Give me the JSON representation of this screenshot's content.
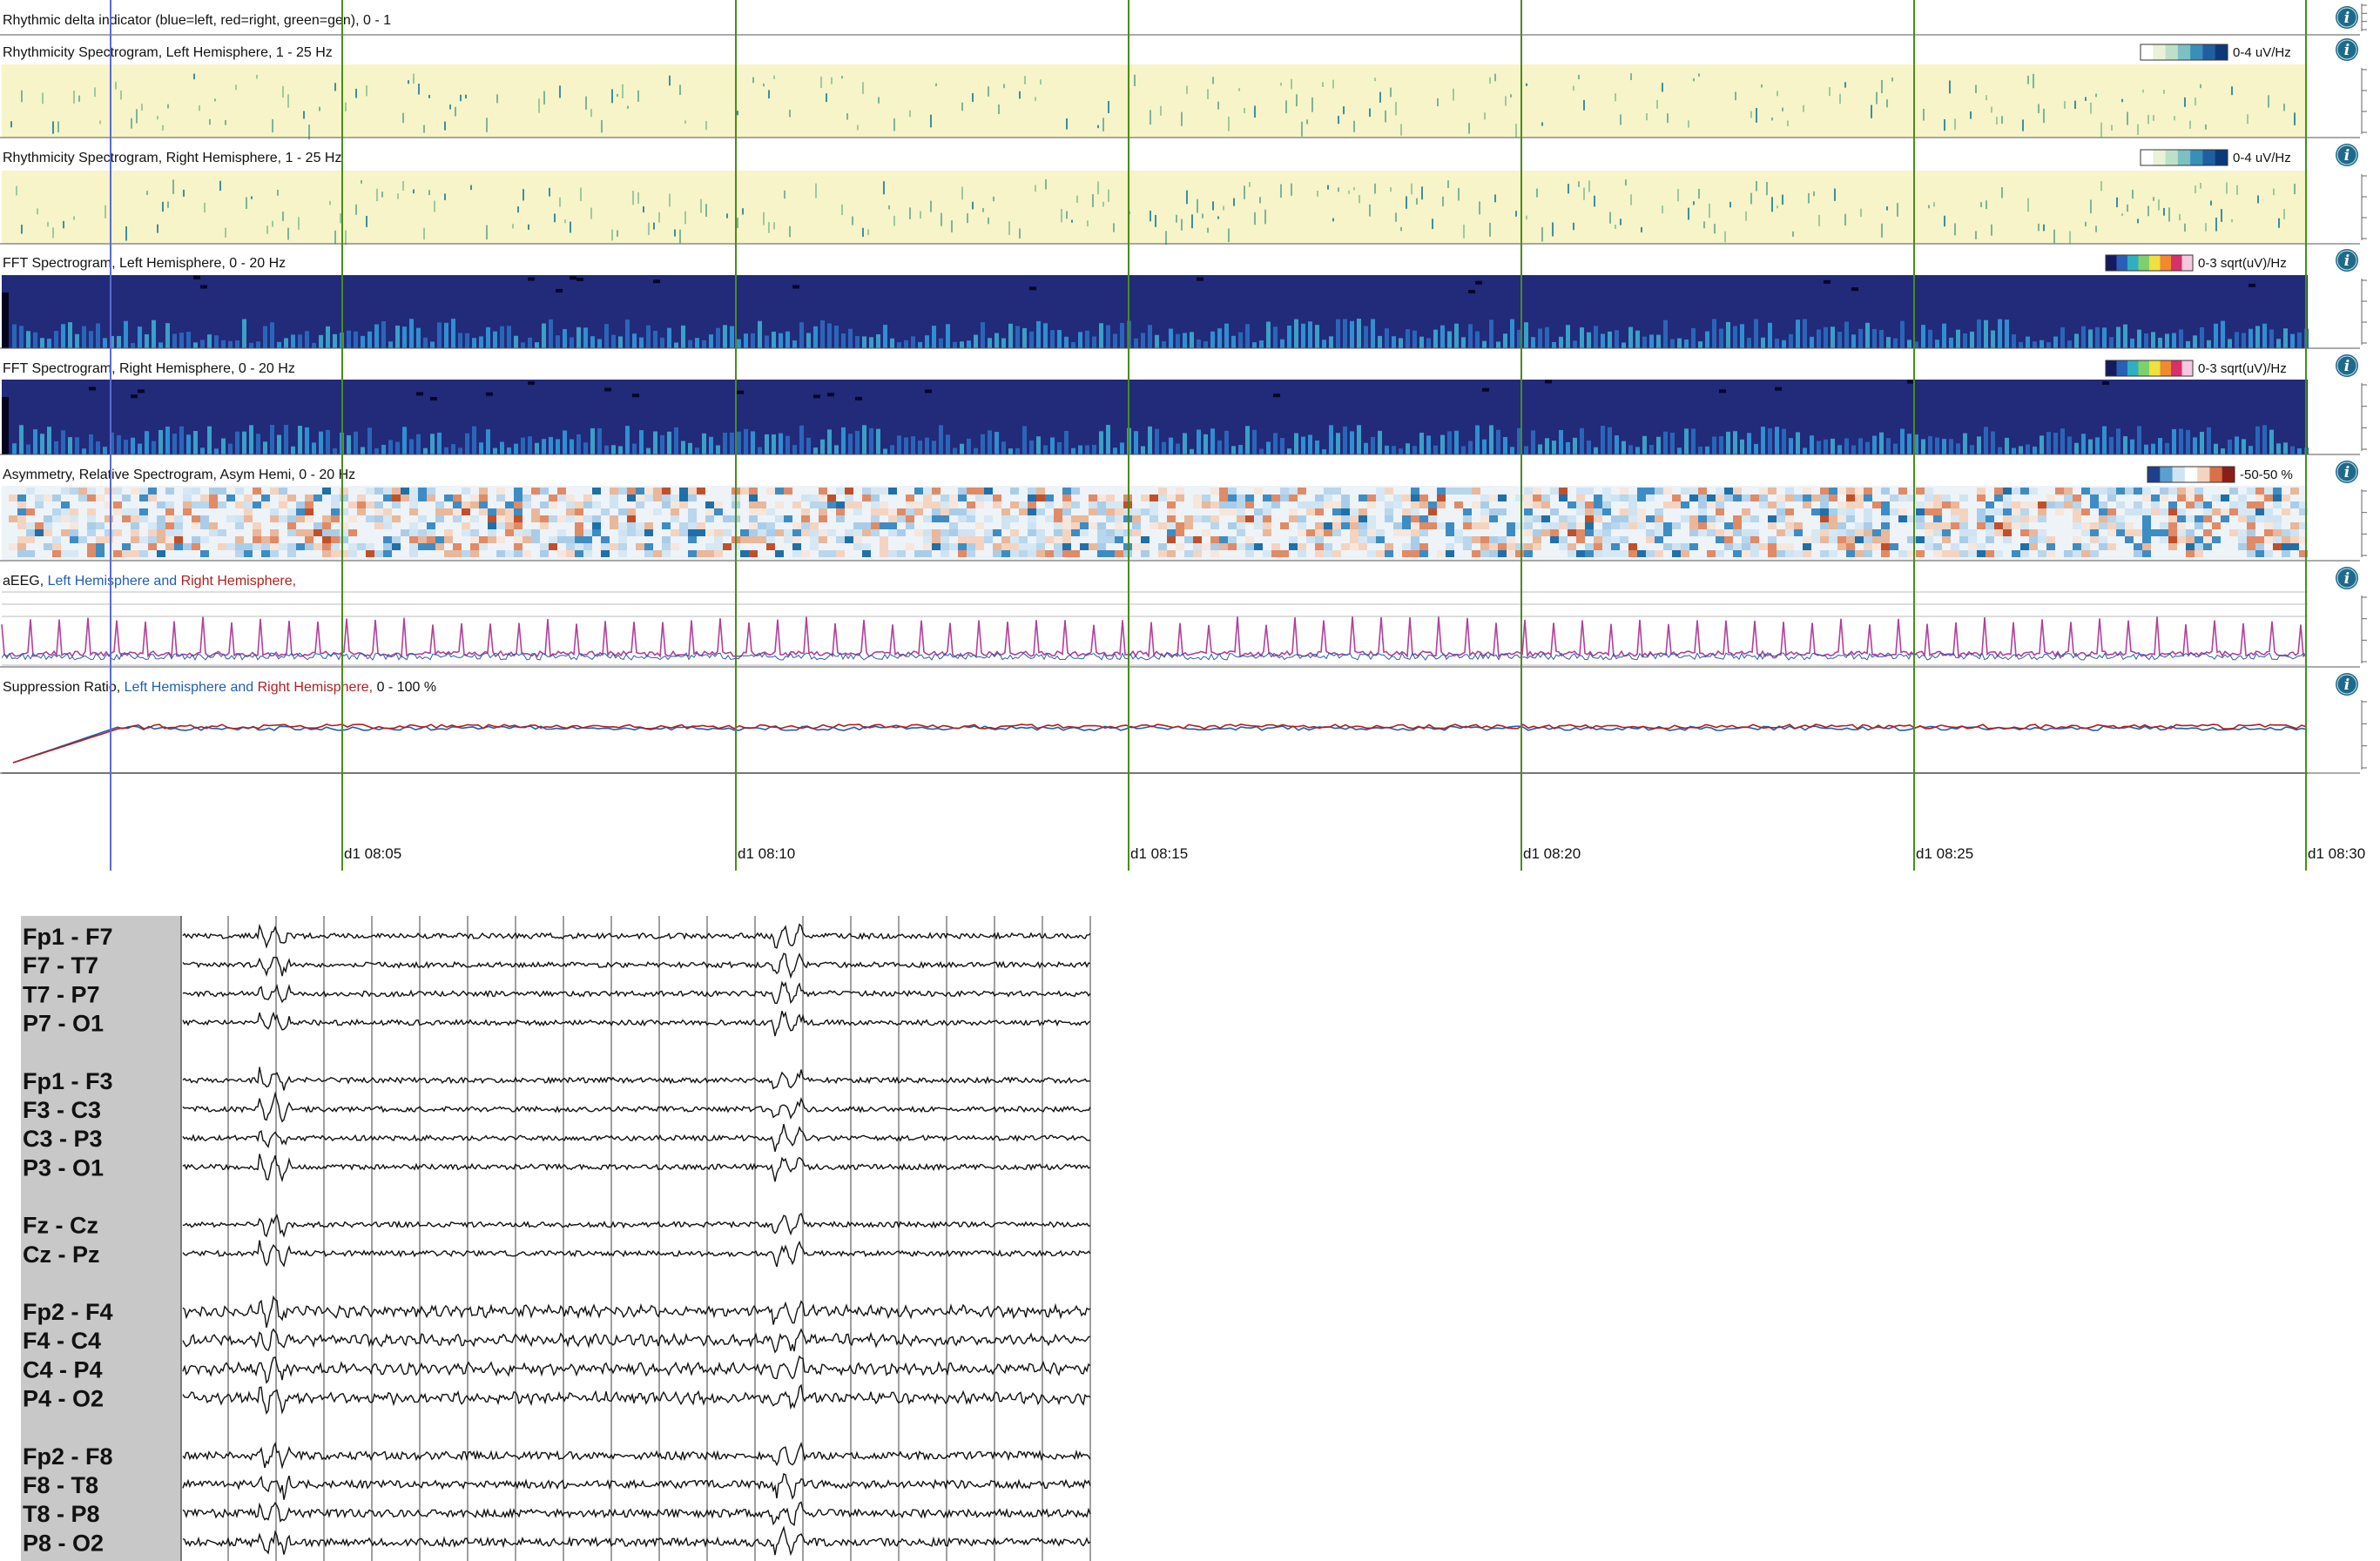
{
  "panels": [
    {
      "id": "delta",
      "title": "Rhythmic delta indicator (blue=left, red=right, green=gen),  0 - 1",
      "kind": "delta"
    },
    {
      "id": "rhy-left",
      "title": "Rhythmicity Spectrogram, Left Hemisphere, 1 - 25 Hz",
      "kind": "rhythm",
      "scale": "0-4 uV/Hz"
    },
    {
      "id": "rhy-right",
      "title": "Rhythmicity Spectrogram, Right Hemisphere, 1 - 25 Hz",
      "kind": "rhythm",
      "scale": "0-4 uV/Hz"
    },
    {
      "id": "fft-left",
      "title": "FFT Spectrogram, Left Hemisphere, 0 - 20 Hz",
      "kind": "fft",
      "scale": "0-3 sqrt(uV)/Hz"
    },
    {
      "id": "fft-right",
      "title": "FFT Spectrogram, Right Hemisphere, 0 - 20 Hz",
      "kind": "fft",
      "scale": "0-3 sqrt(uV)/Hz"
    },
    {
      "id": "asym",
      "title": "Asymmetry, Relative Spectrogram, Asym Hemi, 0 - 20 Hz",
      "kind": "asym",
      "scale": "-50-50 %"
    },
    {
      "id": "aeeg",
      "kind": "aeeg",
      "title_parts": [
        {
          "text": "aEEG, ",
          "color": "#111111"
        },
        {
          "text": "Left Hemisphere",
          "color": "#1f5fb0"
        },
        {
          "text": " and ",
          "color": "#1f5fb0"
        },
        {
          "text": "Right Hemisphere,",
          "color": "#b01f1f"
        }
      ]
    },
    {
      "id": "supp",
      "kind": "supp",
      "title_parts": [
        {
          "text": "Suppression Ratio, ",
          "color": "#111111"
        },
        {
          "text": "Left Hemisphere",
          "color": "#1f5fb0"
        },
        {
          "text": " and ",
          "color": "#1f5fb0"
        },
        {
          "text": "Right Hemisphere,",
          "color": "#b01f1f"
        },
        {
          "text": "  0 - 100 %",
          "color": "#111111"
        }
      ]
    }
  ],
  "time_ticks": [
    "d1 08:05",
    "d1 08:10",
    "d1 08:15",
    "d1 08:20",
    "d1 08:25",
    "d1 08:30"
  ],
  "info_icon": "info-icon",
  "eeg_groups": [
    [
      "Fp1 - F7",
      "F7 - T7",
      "T7 - P7",
      "P7 - O1"
    ],
    [
      "Fp1 - F3",
      "F3 - C3",
      "C3 - P3",
      "P3 - O1"
    ],
    [
      "Fz - Cz",
      "Cz - Pz"
    ],
    [
      "Fp2 - F4",
      "F4 - C4",
      "C4 - P4",
      "P4 - O2"
    ],
    [
      "Fp2 - F8",
      "F8 - T8",
      "T8 - P8",
      "P8 - O2"
    ]
  ],
  "colors": {
    "left": "#1f5fb0",
    "right": "#b01f1f",
    "aeeg_line": "#b0409a",
    "grid_green": "#4a8c1c",
    "cursor": "#5a6cd0",
    "rhythm_bg": "#f6f4c8",
    "fft_bg": "#222a7a",
    "label_gray": "#c8c8c8"
  }
}
